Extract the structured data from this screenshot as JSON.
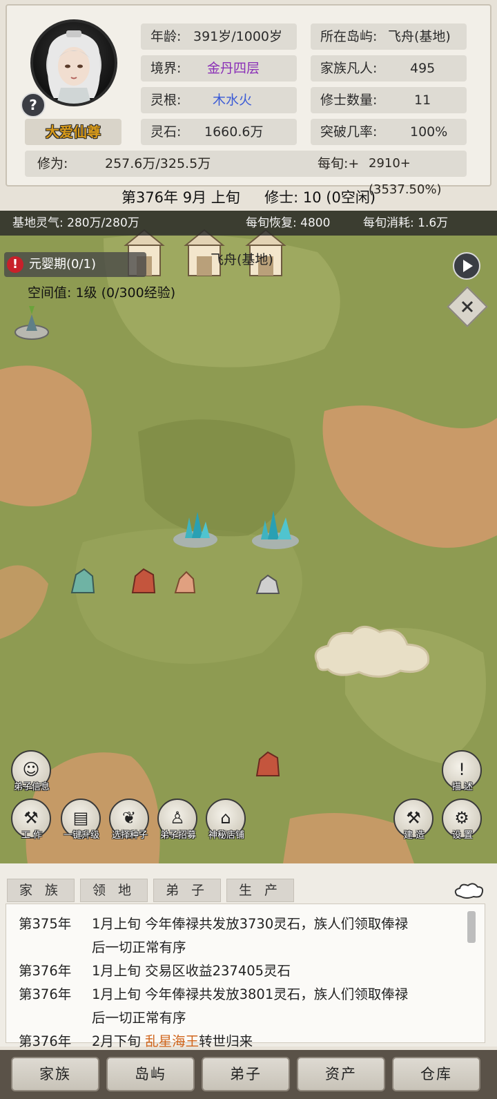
{
  "character": {
    "name": "大爱仙尊",
    "help_glyph": "?",
    "age_label": "年龄:",
    "age_value": "391岁/1000岁",
    "realm_label": "境界:",
    "realm_value": "金丹四层",
    "root_label": "灵根:",
    "root_value": "木水火",
    "stones_label": "灵石:",
    "stones_value": "1660.6万",
    "cultivation_label": "修为:",
    "cultivation_value": "257.6万/325.5万",
    "per_period_label": "每旬:+",
    "per_period_value": "2910+(3537.50%)"
  },
  "island": {
    "location_label": "所在岛屿:",
    "location_value": "飞舟(基地)",
    "mortals_label": "家族凡人:",
    "mortals_value": "495",
    "cultivators_label": "修士数量:",
    "cultivators_value": "11",
    "breakthrough_label": "突破几率:",
    "breakthrough_value": "100%"
  },
  "status": {
    "date_line": "第376年 9月 上旬",
    "cultivators_line": "修士: 10 (0空闲)"
  },
  "qi": {
    "base_qi": "基地灵气: 280万/280万",
    "recovery": "每旬恢复: 4800",
    "consumption": "每旬消耗: 1.6万"
  },
  "map": {
    "base_name": "飞舟(基地)",
    "quest": "元婴期(0/1)",
    "space_value": "空间值: 1级 (0/300经验)",
    "buttons": {
      "disciple_info": "弟子信息",
      "description": "描 述",
      "work": "工 作",
      "one_key_upgrade": "一键升级",
      "select_seeds": "选择种子",
      "recruit": "弟子招募",
      "mystery_shop": "神秘店铺",
      "build": "建 造",
      "settings": "设 置"
    }
  },
  "log": {
    "tabs": [
      "家 族",
      "领 地",
      "弟 子",
      "生 产"
    ],
    "entries": [
      {
        "year": "第375年",
        "text": "1月上旬 今年俸禄共发放3730灵石，族人们领取俸禄",
        "cont": "后一切正常有序"
      },
      {
        "year": "第376年",
        "text": "1月上旬 交易区收益237405灵石"
      },
      {
        "year": "第376年",
        "text": "1月上旬 今年俸禄共发放3801灵石，族人们领取俸禄",
        "cont": "后一切正常有序"
      },
      {
        "year": "第376年",
        "pre": "2月下旬 ",
        "highlight": "乱星海王",
        "post": "转世归来"
      }
    ]
  },
  "nav": [
    "家族",
    "岛屿",
    "弟子",
    "资产",
    "仓库"
  ]
}
